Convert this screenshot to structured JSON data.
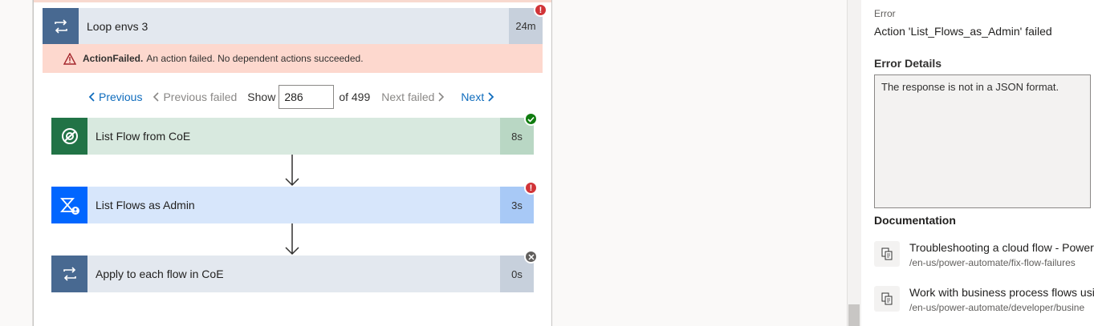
{
  "loop": {
    "title": "Loop envs 3",
    "duration": "24m",
    "status_icon": "error-badge-icon"
  },
  "error_banner": {
    "code": "ActionFailed.",
    "message": "An action failed. No dependent actions succeeded."
  },
  "pager": {
    "previous": "Previous",
    "previous_failed": "Previous failed",
    "show": "Show",
    "current": "286",
    "of_total": "of 499",
    "next_failed": "Next failed",
    "next": "Next"
  },
  "actions": [
    {
      "label": "List Flow from CoE",
      "duration": "8s",
      "status": "success",
      "color": "#217346",
      "bg": "#d8e9df",
      "dur_bg": "#b9d7c4"
    },
    {
      "label": "List Flows as Admin",
      "duration": "3s",
      "status": "error",
      "color": "#0066ff",
      "bg": "#d7e6fb",
      "dur_bg": "#a8c9f6"
    },
    {
      "label": "Apply to each flow in CoE",
      "duration": "0s",
      "status": "skipped",
      "color": "#486991",
      "bg": "#e3e8ef",
      "dur_bg": "#c7d0dc"
    }
  ],
  "panel": {
    "error_label": "Error",
    "error_value": "Action 'List_Flows_as_Admin' failed",
    "details_title": "Error Details",
    "details_text": "The response is not in a JSON format.",
    "documentation_title": "Documentation",
    "docs": [
      {
        "title": "Troubleshooting a cloud flow - Power",
        "path": "/en-us/power-automate/fix-flow-failures"
      },
      {
        "title": "Work with business process flows usi",
        "path": "/en-us/power-automate/developer/busine"
      }
    ]
  }
}
